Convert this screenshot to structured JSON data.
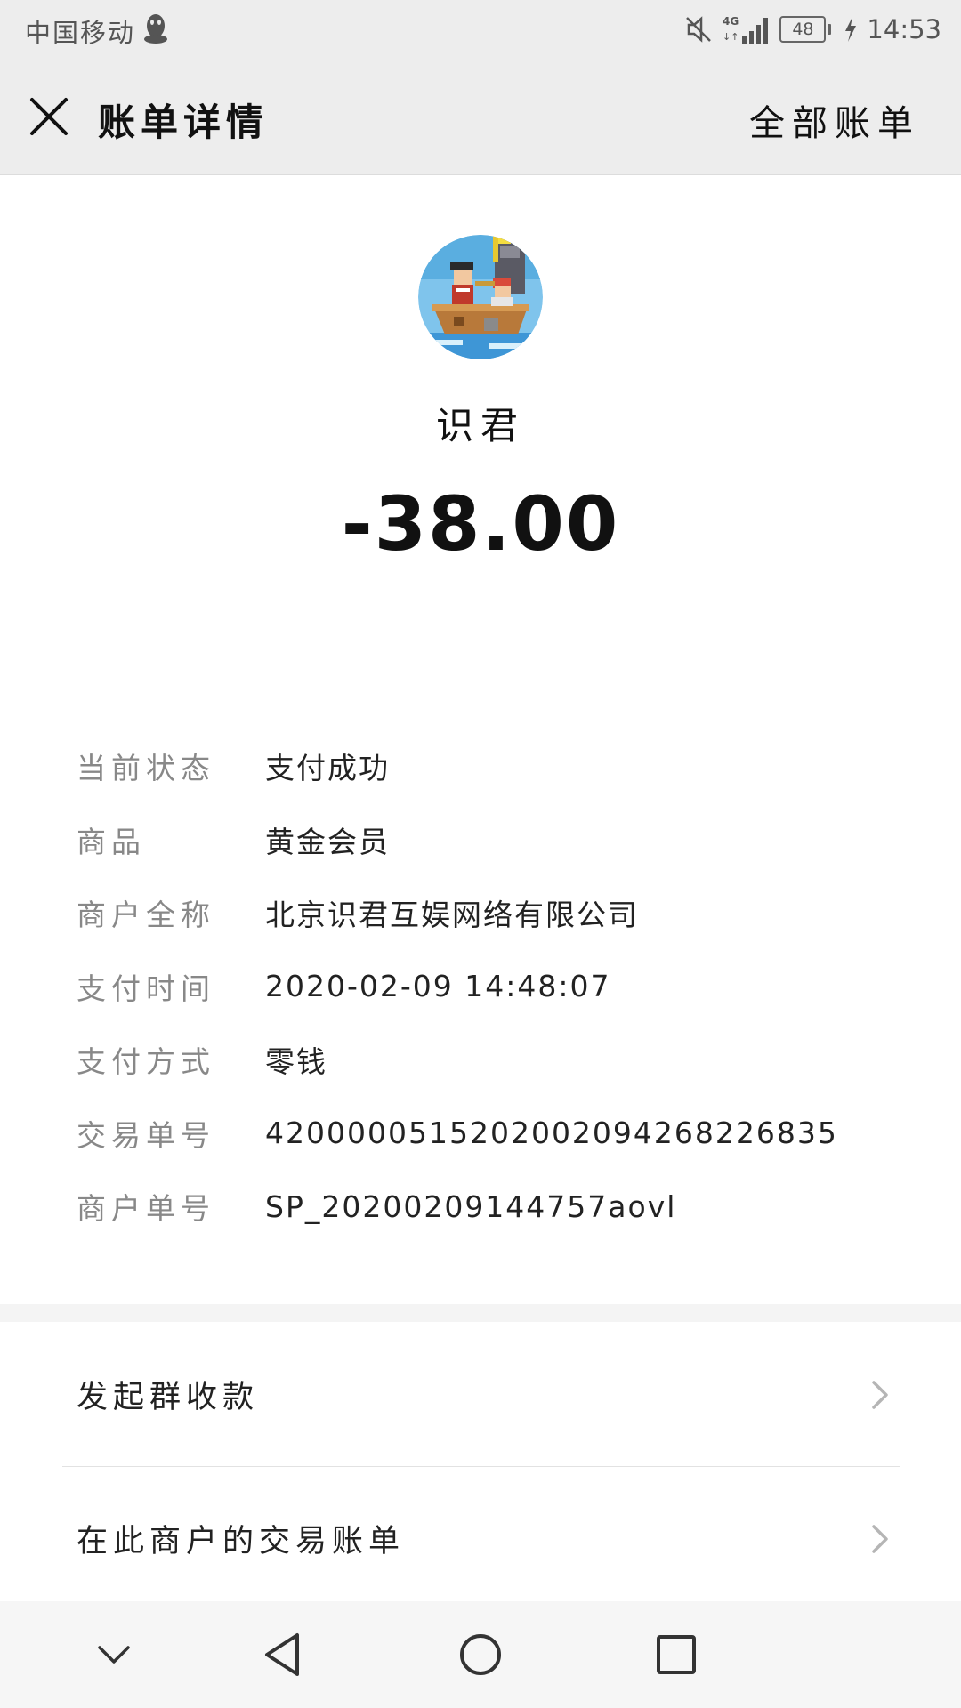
{
  "status_bar": {
    "carrier": "中国移动",
    "network": "4G",
    "battery": "48",
    "time": "14:53"
  },
  "header": {
    "title": "账单详情",
    "all_bills": "全部账单"
  },
  "merchant": {
    "name": "识君",
    "amount": "-38.00"
  },
  "details": [
    {
      "label": "当前状态",
      "value": "支付成功"
    },
    {
      "label": "商品",
      "value": "黄金会员"
    },
    {
      "label": "商户全称",
      "value": "北京识君互娱网络有限公司"
    },
    {
      "label": "支付时间",
      "value": "2020-02-09 14:48:07"
    },
    {
      "label": "支付方式",
      "value": "零钱"
    },
    {
      "label": "交易单号",
      "value": "4200000515202002094268226835"
    },
    {
      "label": "商户单号",
      "value": "SP_20200209144757aovl"
    }
  ],
  "actions": {
    "group_collect": "发起群收款",
    "merchant_bills": "在此商户的交易账单"
  },
  "icons": {
    "close": "close-icon",
    "chevron": "chevron-right-icon",
    "nav_hide": "chevron-down-icon",
    "nav_back": "triangle-back-icon",
    "nav_home": "circle-home-icon",
    "nav_recent": "square-recent-icon"
  },
  "colors": {
    "header_bg": "#ededed",
    "label_gray": "#888888",
    "text_dark": "#111111"
  }
}
